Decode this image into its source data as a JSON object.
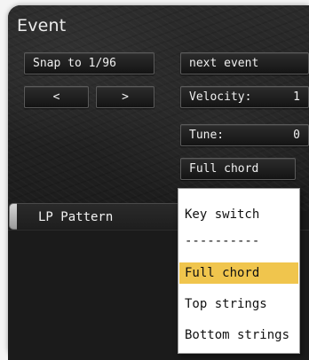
{
  "panel": {
    "title": "Event"
  },
  "controls": {
    "snap_label": "Snap to 1/96",
    "prev_label": "<",
    "next_label": ">",
    "next_event_label": "next event",
    "velocity_label": "Velocity:",
    "velocity_value": "1",
    "tune_label": "Tune:",
    "tune_value": "0",
    "mode_selected": "Full chord"
  },
  "tab": {
    "label": "LP Pattern"
  },
  "dropdown": {
    "items": [
      {
        "label": "Key switch",
        "selected": false
      },
      {
        "label": "----------",
        "selected": false
      },
      {
        "label": "Full chord",
        "selected": true
      },
      {
        "label": "Top strings",
        "selected": false
      },
      {
        "label": "Bottom strings",
        "selected": false
      }
    ]
  },
  "colors": {
    "selected_highlight": "#f0c54d",
    "panel_background": "#232323",
    "button_text": "#f0f0f0"
  }
}
